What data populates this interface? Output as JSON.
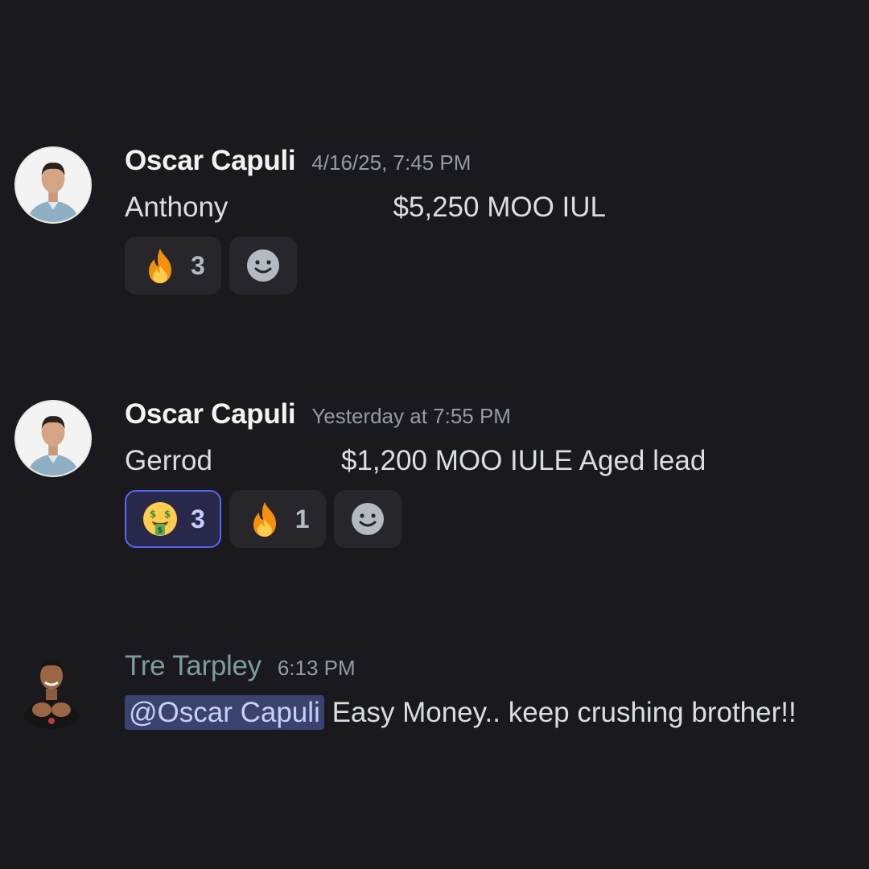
{
  "messages": [
    {
      "author": "Oscar Capuli",
      "timestamp": "4/16/25, 7:45 PM",
      "text_left": "Anthony",
      "text_right": "$5,250 MOO IUL",
      "reactions": [
        {
          "emoji": "fire-emoji",
          "count": "3",
          "active": false
        }
      ]
    },
    {
      "author": "Oscar Capuli",
      "timestamp": "Yesterday at 7:55 PM",
      "text_left": "Gerrod",
      "text_right": "$1,200 MOO IULE Aged lead",
      "reactions": [
        {
          "emoji": "money-mouth-face-emoji",
          "count": "3",
          "active": true
        },
        {
          "emoji": "fire-emoji",
          "count": "1",
          "active": false
        }
      ]
    },
    {
      "author": "Tre Tarpley",
      "timestamp": "6:13 PM",
      "mention": "@Oscar Capuli",
      "text": "Easy Money.. keep crushing brother!!"
    }
  ],
  "colors": {
    "background": "#1a1a1e",
    "accent": "#5865f2",
    "mention_bg": "#3c4270",
    "username_teal": "#7d9ba0"
  },
  "icons": [
    "fire-emoji",
    "money-mouth-face-emoji",
    "add-reaction-smiley-icon"
  ]
}
